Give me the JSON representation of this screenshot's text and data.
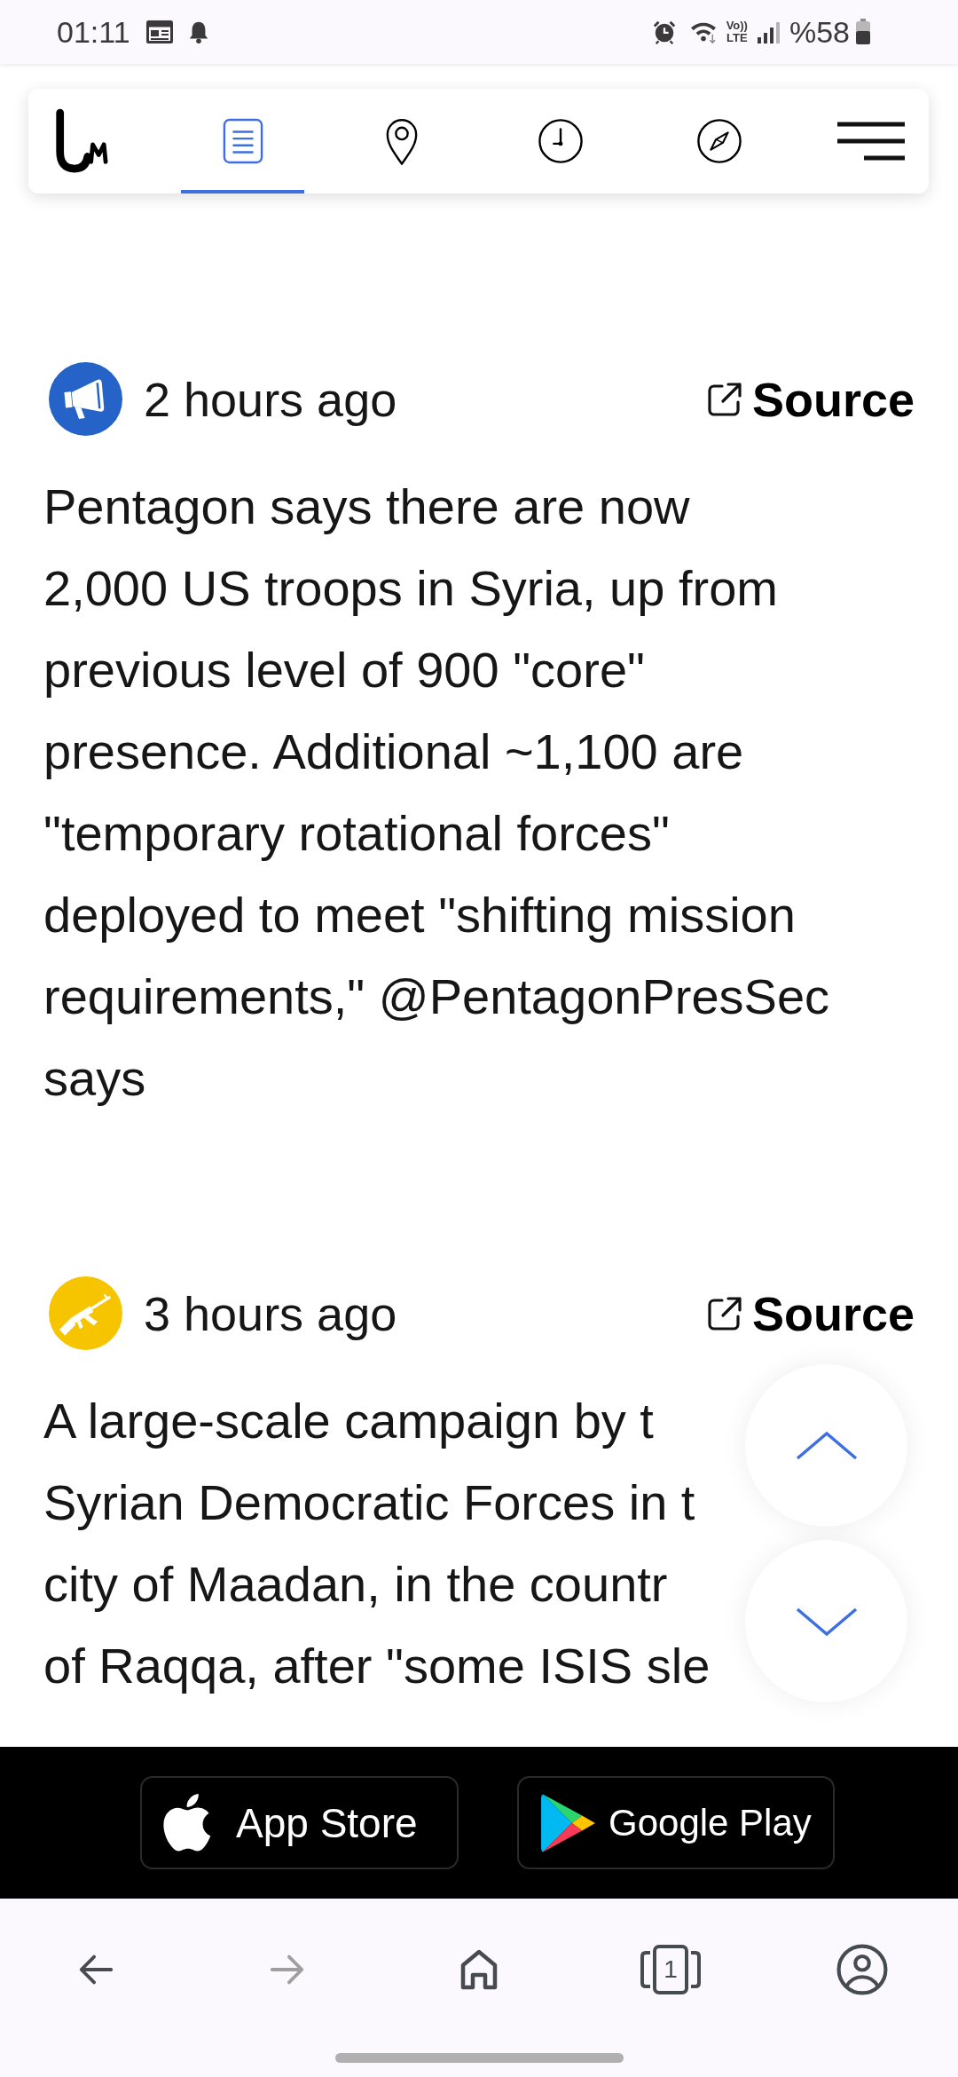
{
  "status_bar": {
    "time": "01:11",
    "network_badge": "Vo))\nLTE",
    "battery_text": "%58"
  },
  "nav_bar": {
    "tabs": [
      {
        "kind": "list",
        "selected": true
      },
      {
        "kind": "pin",
        "selected": false
      },
      {
        "kind": "clock",
        "selected": false
      },
      {
        "kind": "compass",
        "selected": false
      }
    ]
  },
  "feed": {
    "entries": [
      {
        "kind": "megaphone",
        "color": "#2563c9",
        "time": "2 hours ago",
        "source": "Source",
        "text": "Pentagon says there are now\n2,000 US troops in Syria, up from\nprevious level of 900 \"core\"\npresence. Additional ~1,100 are\n\"temporary rotational forces\"\ndeployed to meet \"shifting mission\nrequirements,\" @PentagonPresSec\nsays"
      },
      {
        "kind": "rifle",
        "color": "#f6c500",
        "time": "3 hours ago",
        "source": "Source",
        "text": "A large-scale campaign by t\nSyrian Democratic Forces in t\ncity of Maadan, in the countr\nof Raqqa, after \"some ISIS sle"
      }
    ]
  },
  "scroll_buttons": [
    {
      "kind": "up"
    },
    {
      "kind": "down"
    }
  ],
  "store_bar": {
    "buttons": [
      {
        "kind": "apple",
        "label": "App Store"
      },
      {
        "kind": "google",
        "label": "Google Play"
      }
    ]
  },
  "browser_bar": {
    "buttons": [
      {
        "kind": "back",
        "disabled": false
      },
      {
        "kind": "forward",
        "disabled": true
      },
      {
        "kind": "home",
        "disabled": false
      },
      {
        "kind": "tabs",
        "count": "1",
        "disabled": false
      },
      {
        "kind": "profile",
        "disabled": false
      }
    ]
  }
}
